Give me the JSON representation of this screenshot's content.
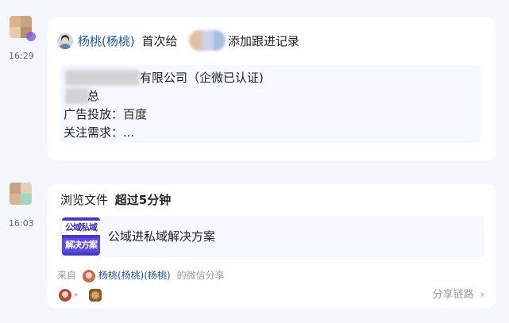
{
  "entries": [
    {
      "time": "16:29",
      "actor_name": "杨桃(杨桃)",
      "action_prefix": "首次给",
      "action_suffix": "添加跟进记录",
      "details": {
        "company_suffix": "有限公司（企微已认证)",
        "title_suffix": "总",
        "ad_line": "广告投放：百度",
        "focus_line": "关注需求：..."
      }
    },
    {
      "time": "16:03",
      "event_prefix": "浏览文件",
      "event_strong": "超过5分钟",
      "file": {
        "thumb_line1": "公域私域",
        "thumb_line2": "解决方案",
        "title": "公域进私域解决方案"
      },
      "source_prefix": "来自",
      "source_name": "杨桃(杨桃)(杨桃)",
      "source_suffix": "的微信分享",
      "share_link": "分享链路",
      "share_arrow": "›",
      "path_arrow": "▸"
    }
  ],
  "colors": {
    "page_bg": "#f3f6fb",
    "card_bg": "#ffffff",
    "link_blue": "#1e5aa8",
    "muted": "#999999",
    "thumb_purple": "#4a37c8"
  }
}
